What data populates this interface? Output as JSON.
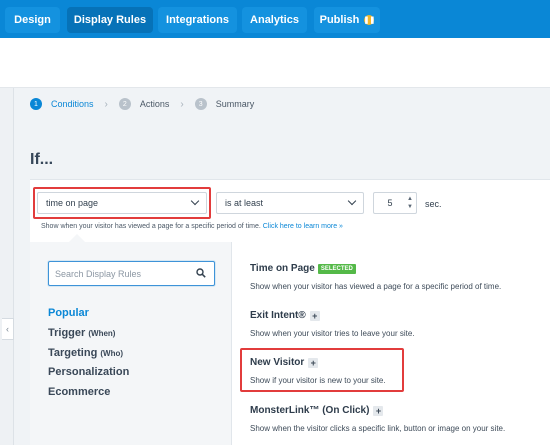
{
  "topnav": {
    "tabs": [
      {
        "label": "Design"
      },
      {
        "label": "Display Rules",
        "active": true
      },
      {
        "label": "Integrations"
      },
      {
        "label": "Analytics"
      },
      {
        "label": "Publish"
      }
    ],
    "publish_badge_icon": "pause-icon",
    "accent_color": "#0a87d6"
  },
  "steps": [
    {
      "num": "1",
      "label": "Conditions",
      "active": true
    },
    {
      "num": "2",
      "label": "Actions"
    },
    {
      "num": "3",
      "label": "Summary"
    }
  ],
  "heading": "If...",
  "rule": {
    "condition_value": "time on page",
    "operator_value": "is at least",
    "number_value": "5",
    "unit": "sec.",
    "helper_text": "Show when your visitor has viewed a page for a specific period of time.",
    "helper_link": "Click here to learn more »"
  },
  "search": {
    "placeholder": "Search Display Rules"
  },
  "categories": [
    {
      "label": "Popular",
      "active": true
    },
    {
      "label": "Trigger",
      "suffix": "(When)"
    },
    {
      "label": "Targeting",
      "suffix": "(Who)"
    },
    {
      "label": "Personalization"
    },
    {
      "label": "Ecommerce"
    }
  ],
  "rules_list": [
    {
      "title": "Time on Page",
      "badge": "SELECTED",
      "desc": "Show when your visitor has viewed a page for a specific period of time."
    },
    {
      "title": "Exit Intent®",
      "badge": "+",
      "desc": "Show when your visitor tries to leave your site."
    },
    {
      "title": "New Visitor",
      "badge": "+",
      "desc": "Show if your visitor is new to your site."
    },
    {
      "title": "MonsterLink™ (On Click)",
      "badge": "+",
      "desc": "Show when the visitor clicks a specific link, button or image on your site."
    }
  ],
  "colors": {
    "selected_badge": "#54b948",
    "highlight": "#e23c3c"
  }
}
